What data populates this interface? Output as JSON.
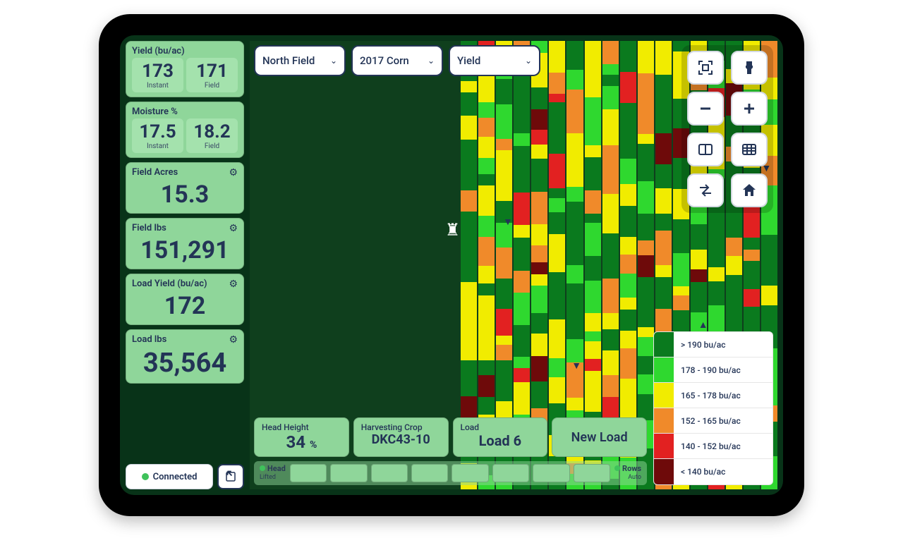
{
  "sidebar": {
    "yield": {
      "label": "Yield (bu/ac)",
      "instant": "173",
      "instant_t": "Instant",
      "field": "171",
      "field_t": "Field"
    },
    "moisture": {
      "label": "Moisture %",
      "instant": "17.5",
      "instant_t": "Instant",
      "field": "18.2",
      "field_t": "Field"
    },
    "acres": {
      "label": "Field Acres",
      "value": "15.3"
    },
    "fieldlbs": {
      "label": "Field lbs",
      "value": "151,291"
    },
    "loadyield": {
      "label": "Load Yield (bu/ac)",
      "value": "172"
    },
    "loadlbs": {
      "label": "Load lbs",
      "value": "35,564"
    },
    "connected": "Connected"
  },
  "top": {
    "field": "North Field",
    "crop": "2017 Corn",
    "layer": "Yield"
  },
  "legend": [
    {
      "color": "#0a7a1e",
      "label": "> 190 bu/ac"
    },
    {
      "color": "#2fd82f",
      "label": "178 - 190 bu/ac"
    },
    {
      "color": "#f1ec00",
      "label": "165 - 178 bu/ac"
    },
    {
      "color": "#f08a2a",
      "label": "152 - 165 bu/ac"
    },
    {
      "color": "#e22121",
      "label": "140 - 152 bu/ac"
    },
    {
      "color": "#6e0a0a",
      "label": "< 140 bu/ac"
    }
  ],
  "bottom": {
    "head_height_label": "Head Height",
    "head_height_value": "34",
    "head_height_pct": "%",
    "crop_label": "Harvesting Crop",
    "crop_value": "DKC43-10",
    "load_label": "Load",
    "load_value": "Load 6",
    "new_load": "New Load",
    "head": "Head",
    "head_sub": "Lifted",
    "rows": "Rows",
    "rows_sub": "Auto"
  },
  "colors": [
    "#0a7a1e",
    "#2fd82f",
    "#f1ec00",
    "#f08a2a",
    "#e22121",
    "#6e0a0a"
  ]
}
